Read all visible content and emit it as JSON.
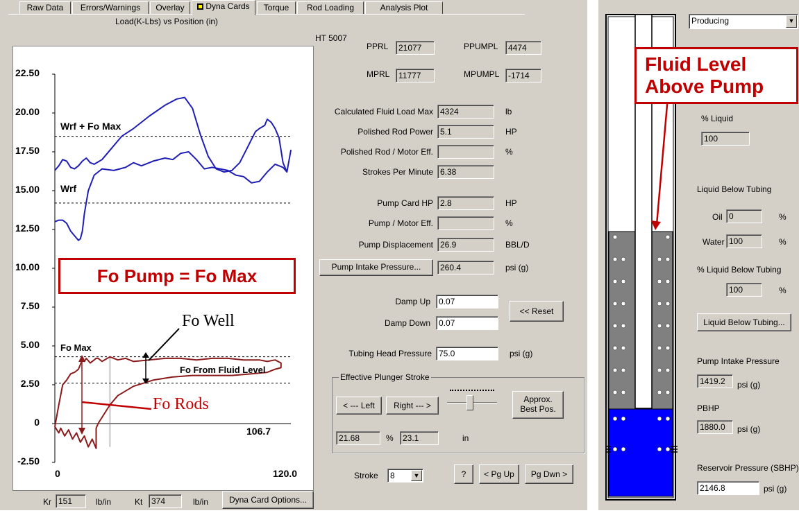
{
  "tabs": [
    "Raw Data",
    "Errors/Warnings",
    "Overlay",
    "Dyna Cards",
    "Torque",
    "Rod Loading",
    "Analysis Plot"
  ],
  "chart": {
    "title": "Load(K-Lbs) vs Position (in)",
    "y_ticks": [
      "22.50",
      "20.00",
      "17.50",
      "15.00",
      "12.50",
      "10.00",
      "7.50",
      "5.00",
      "2.50",
      "0",
      "-2.50"
    ],
    "x_start": "0",
    "x_end": "120.0",
    "surface_end": "106.7",
    "ref_lines": {
      "wrf_fo_max": "Wrf + Fo Max",
      "wrf": "Wrf",
      "fo_max": "Fo Max",
      "fo_fluid": "Fo From Fluid Level"
    }
  },
  "chart_data": {
    "type": "line",
    "title": "Load(K-Lbs) vs Position (in)",
    "ylim": [
      -2.5,
      22.5
    ],
    "xlim": [
      0,
      120
    ],
    "reference_lines": [
      {
        "name": "Wrf + Fo Max",
        "y": 18.5
      },
      {
        "name": "Wrf",
        "y": 14.2
      },
      {
        "name": "Fo Max",
        "y": 4.3
      },
      {
        "name": "Fo From Fluid Level",
        "y": 2.6
      }
    ],
    "series": [
      {
        "color": "#1e1eb4",
        "x": [
          0,
          2,
          4,
          6,
          8,
          10,
          12,
          14,
          16,
          18,
          20,
          24,
          28,
          34,
          40,
          48,
          56,
          62,
          66,
          70,
          74,
          78,
          82,
          86,
          90,
          94,
          98,
          100,
          102,
          104,
          106.7,
          108,
          110,
          112,
          114,
          116,
          118,
          120,
          120,
          118,
          116,
          112,
          108,
          104,
          100,
          96,
          92,
          88,
          84,
          80,
          76,
          72,
          68,
          64,
          60,
          56,
          50,
          44,
          40,
          36,
          30,
          24,
          20,
          17,
          15,
          14,
          13,
          12,
          10,
          8,
          6,
          4,
          2,
          0
        ],
        "y": [
          16.3,
          16.6,
          17.0,
          16.9,
          16.5,
          16.4,
          16.6,
          16.9,
          17.1,
          16.8,
          16.7,
          17.0,
          17.6,
          18.5,
          19.0,
          19.8,
          20.5,
          20.9,
          21.0,
          20.3,
          18.6,
          17.2,
          16.4,
          16.2,
          16.3,
          16.8,
          17.8,
          18.3,
          18.8,
          19.0,
          19.2,
          19.6,
          19.4,
          19.0,
          18.4,
          16.8,
          16.2,
          17.6,
          17.6,
          16.2,
          16.5,
          16.7,
          16.2,
          15.6,
          15.5,
          15.9,
          16.0,
          16.3,
          16.4,
          16.5,
          16.4,
          17.0,
          17.5,
          17.4,
          17.0,
          17.1,
          16.9,
          16.6,
          16.8,
          16.5,
          16.3,
          16.4,
          16.0,
          15.0,
          13.5,
          12.4,
          11.9,
          11.8,
          12.1,
          12.4,
          12.9,
          13.1,
          13.1,
          13.0
        ]
      },
      {
        "color": "#8b1a1a",
        "x": [
          0,
          2,
          3,
          5,
          7,
          9,
          11,
          13,
          15,
          17,
          19,
          21,
          21,
          22,
          24,
          28,
          32,
          40,
          50,
          60,
          70,
          80,
          90,
          100,
          108,
          112,
          115,
          115,
          112,
          108,
          104,
          96,
          88,
          80,
          72,
          64,
          56,
          48,
          40,
          36,
          32,
          28,
          24,
          22,
          21,
          20,
          18,
          16,
          15,
          14,
          14,
          13,
          12,
          10,
          8,
          6,
          4,
          2,
          0
        ],
        "y": [
          -0.2,
          -0.6,
          -0.3,
          -0.8,
          -0.4,
          -1.0,
          -0.6,
          -1.2,
          -0.8,
          -1.5,
          -1.0,
          -1.6,
          -0.3,
          0.0,
          0.4,
          1.2,
          1.8,
          2.4,
          2.8,
          3.0,
          3.1,
          3.1,
          3.1,
          3.2,
          3.3,
          3.5,
          3.6,
          3.9,
          4.1,
          4.0,
          4.1,
          4.1,
          4.2,
          4.2,
          4.1,
          4.2,
          4.2,
          4.1,
          4.0,
          4.2,
          4.1,
          4.3,
          4.0,
          4.2,
          4.2,
          4.1,
          3.9,
          4.2,
          4.0,
          4.3,
          4.1,
          3.8,
          3.5,
          3.3,
          3.2,
          2.8,
          2.5,
          1.2,
          -0.2
        ]
      }
    ]
  },
  "annotations": {
    "fo_pump": "Fo Pump = Fo Max",
    "fo_well": "Fo Well",
    "fo_rods": "Fo Rods",
    "fluid_level": "Fluid Level Above Pump"
  },
  "well_id": "HT 5007",
  "pprl": {
    "label": "PPRL",
    "value": "21077"
  },
  "ppumpl": {
    "label": "PPUMPL",
    "value": "4474"
  },
  "mprl": {
    "label": "MPRL",
    "value": "11777"
  },
  "mpumpl": {
    "label": "MPUMPL",
    "value": "-1714"
  },
  "rows": [
    {
      "label": "Calculated Fluid Load Max",
      "value": "4324",
      "unit": "lb"
    },
    {
      "label": "Polished Rod Power",
      "value": "5.1",
      "unit": "HP"
    },
    {
      "label": "Polished Rod / Motor Eff.",
      "value": "",
      "unit": "%"
    },
    {
      "label": "Strokes Per Minute",
      "value": "6.38",
      "unit": ""
    },
    {
      "label": "Pump Card HP",
      "value": "2.8",
      "unit": "HP"
    },
    {
      "label": "Pump / Motor Eff.",
      "value": "",
      "unit": "%"
    },
    {
      "label": "Pump Displacement",
      "value": "26.9",
      "unit": "BBL/D"
    }
  ],
  "pip_button": "Pump Intake Pressure...",
  "pip_value": "260.4",
  "pip_unit": "psi (g)",
  "damp_up": {
    "label": "Damp Up",
    "value": "0.07"
  },
  "damp_down": {
    "label": "Damp Down",
    "value": "0.07"
  },
  "reset_button": "<< Reset",
  "thp": {
    "label": "Tubing Head Pressure",
    "value": "75.0",
    "unit": "psi (g)"
  },
  "eps": {
    "title": "Effective Plunger Stroke",
    "left_button": "< --- Left",
    "right_button": "Right --- >",
    "approx_button": "Approx. Best Pos.",
    "left_value": "21.68",
    "pct": "%",
    "right_value": "23.1",
    "unit": "in"
  },
  "stroke": {
    "label": "Stroke",
    "value": "8"
  },
  "help_button": "?",
  "pgup_button": "< Pg Up",
  "pgdn_button": "Pg Dwn >",
  "bottom": {
    "kr_label": "Kr",
    "kr_value": "151",
    "kr_unit": "lb/in",
    "kt_label": "Kt",
    "kt_value": "374",
    "kt_unit": "lb/in",
    "options_button": "Dyna Card Options..."
  },
  "right": {
    "status": "Producing",
    "pct_liquid_label": "% Liquid",
    "pct_liquid_value": "100",
    "liquid_below_label": "Liquid Below Tubing",
    "oil_label": "Oil",
    "oil_value": "0",
    "oil_unit": "%",
    "water_label": "Water",
    "water_value": "100",
    "water_unit": "%",
    "pct_liq_below_label": "% Liquid Below Tubing",
    "pct_liq_below_value": "100",
    "pct_liq_below_unit": "%",
    "liquid_below_button": "Liquid Below Tubing...",
    "pip_label": "Pump Intake Pressure",
    "pip_value": "1419.2",
    "pip_unit": "psi (g)",
    "pbhp_label": "PBHP",
    "pbhp_value": "1880.0",
    "pbhp_unit": "psi (g)",
    "sbhp_label": "Reservoir Pressure (SBHP)",
    "sbhp_value": "2146.8",
    "sbhp_unit": "psi (g)"
  }
}
